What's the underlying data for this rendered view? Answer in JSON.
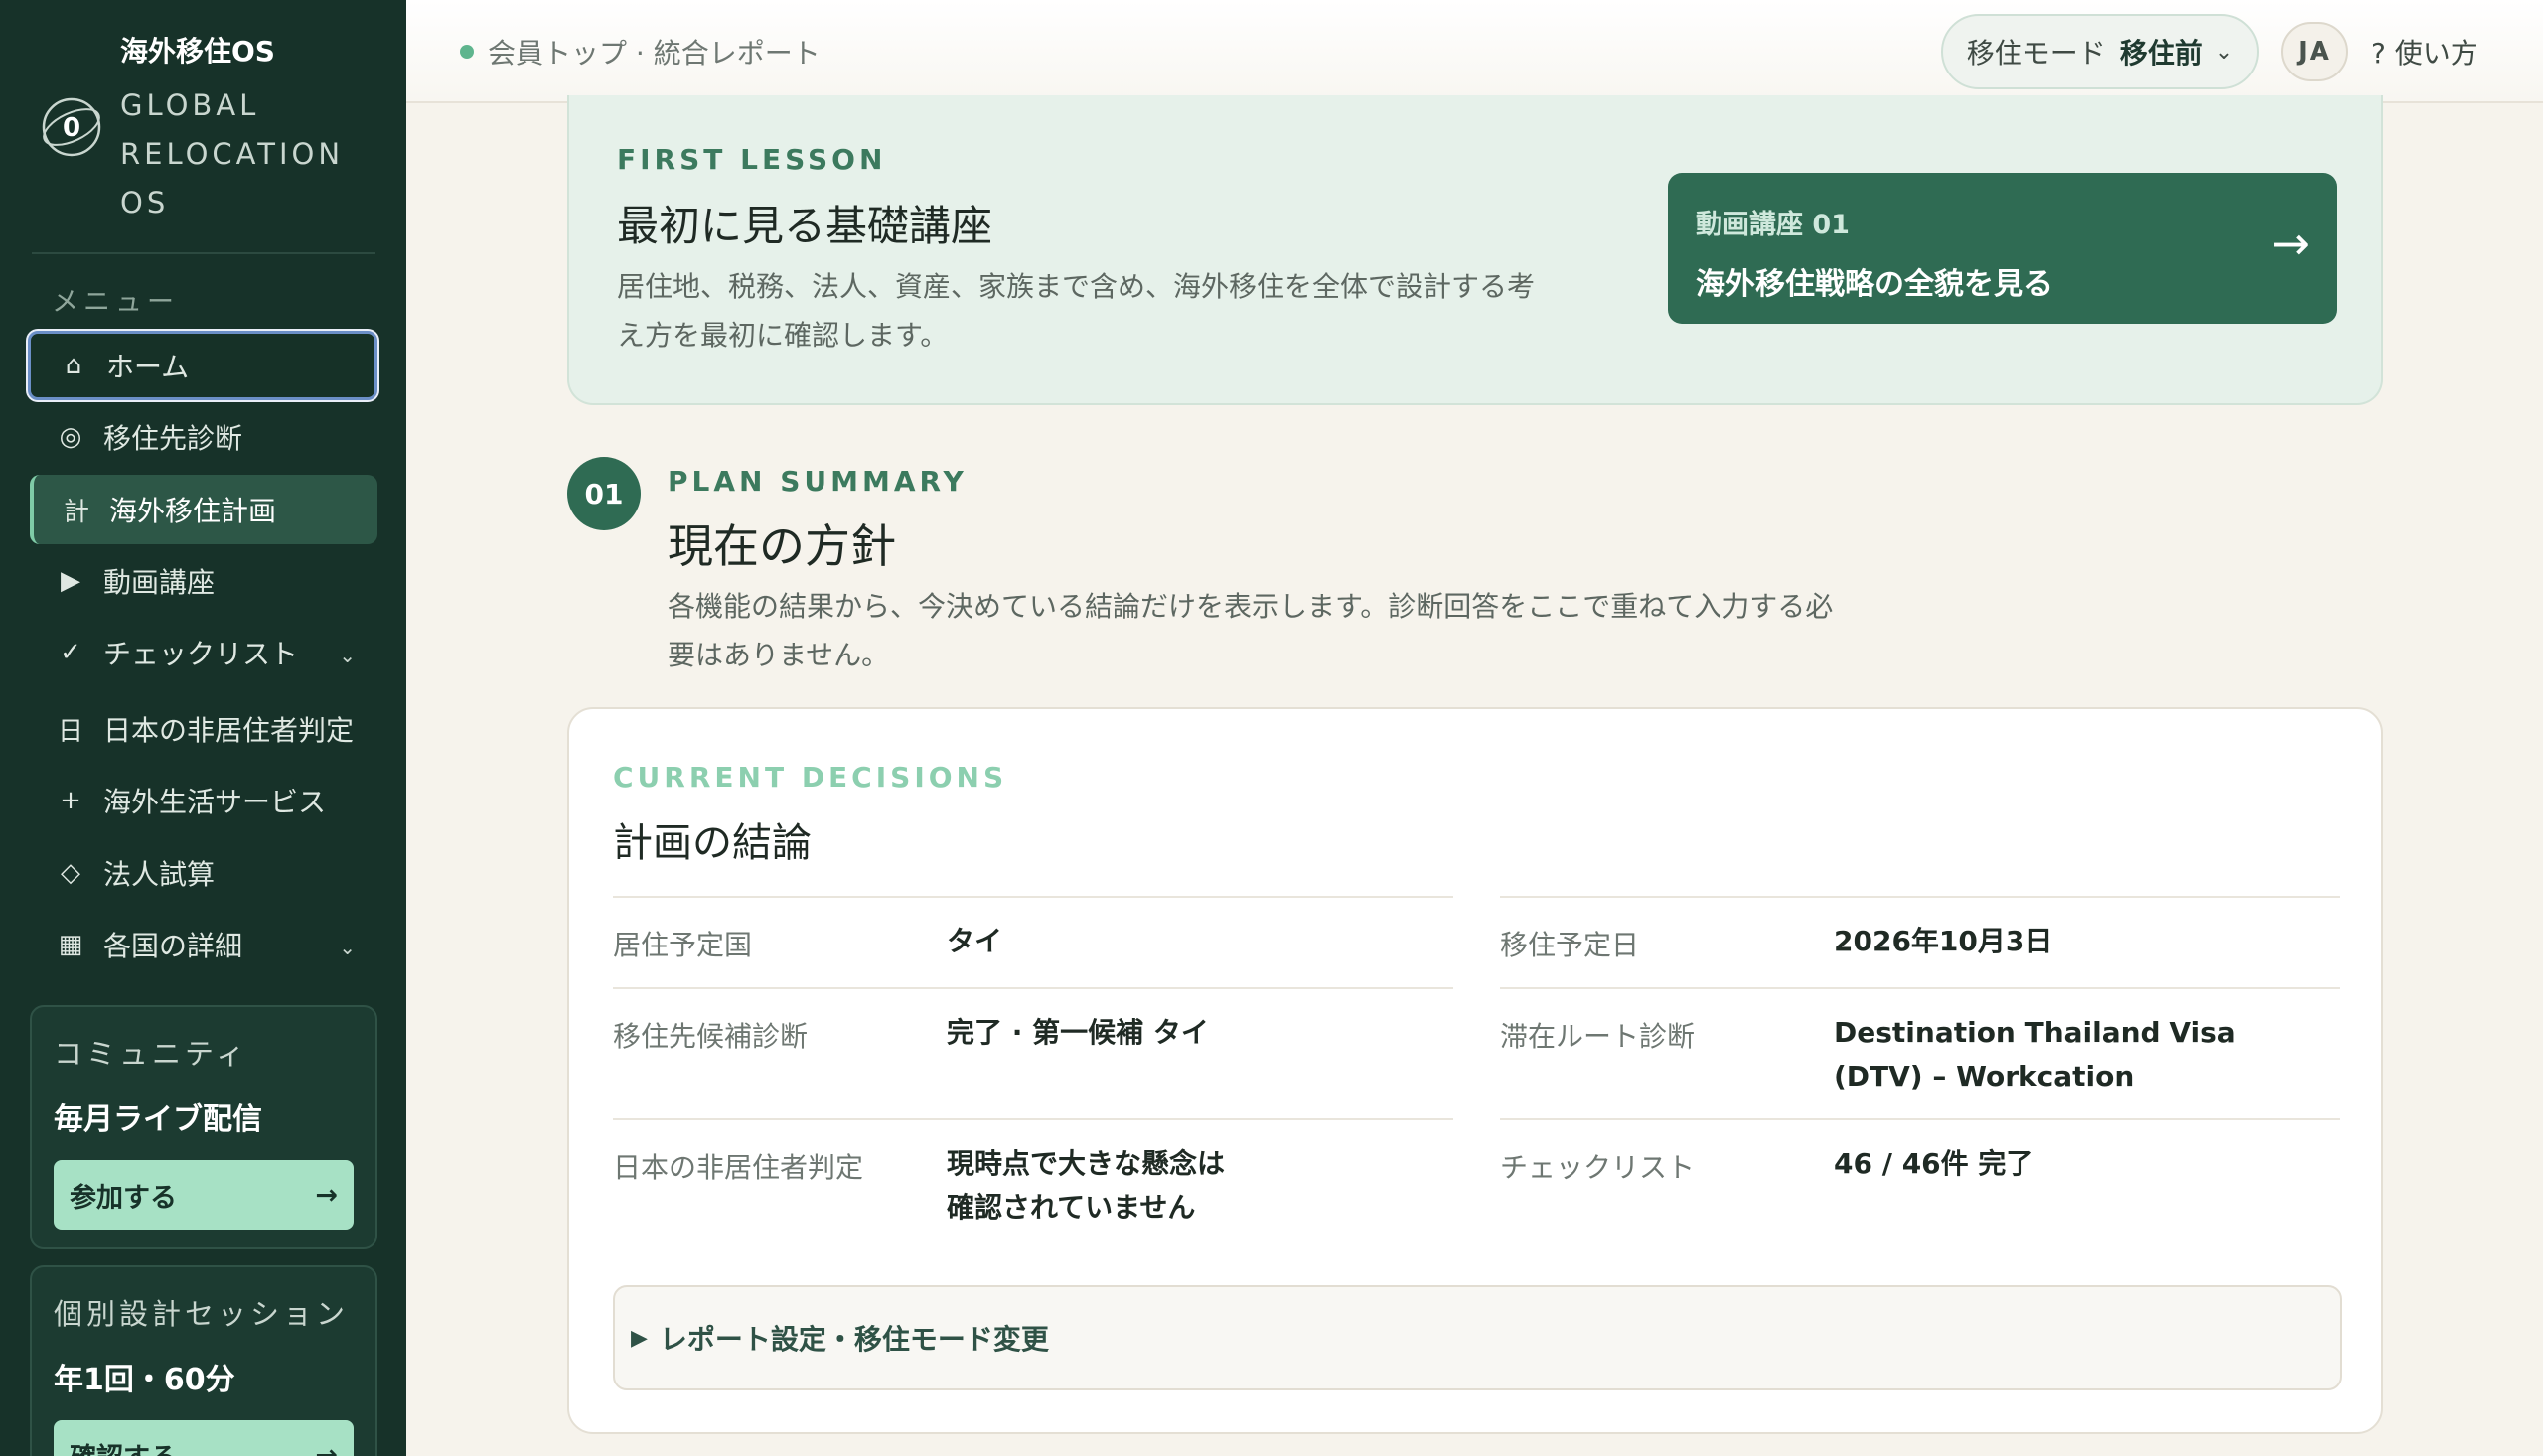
{
  "sidebar": {
    "brand_title": "海外移住OS",
    "brand_logo_letter": "0",
    "brand_sub": "GLOBAL RELOCATION OS",
    "menu_heading": "メニュー",
    "items": [
      {
        "icon": "⌂",
        "icon_name": "home-icon",
        "label": "ホーム"
      },
      {
        "icon": "◎",
        "icon_name": "target-icon",
        "label": "移住先診断"
      },
      {
        "icon": "計",
        "icon_name": "plan-icon",
        "label": "海外移住計画"
      },
      {
        "icon": "▶",
        "icon_name": "play-icon",
        "label": "動画講座"
      },
      {
        "icon": "✓",
        "icon_name": "check-icon",
        "label": "チェックリスト",
        "chevron": "⌄"
      },
      {
        "icon": "日",
        "icon_name": "japan-icon",
        "label": "日本の非居住者判定"
      },
      {
        "icon": "+",
        "icon_name": "plus-icon",
        "label": "海外生活サービス"
      },
      {
        "icon": "◇",
        "icon_name": "diamond-icon",
        "label": "法人試算"
      },
      {
        "icon": "▦",
        "icon_name": "grid-icon",
        "label": "各国の詳細",
        "chevron": "⌄"
      }
    ],
    "community": {
      "label": "コミュニティ",
      "title": "毎月ライブ配信",
      "button": "参加する",
      "arrow": "→"
    },
    "session": {
      "label": "個別設計セッション",
      "title": "年1回・60分",
      "button": "確認する",
      "arrow": "→"
    }
  },
  "topbar": {
    "breadcrumb": "会員トップ · 統合レポート",
    "mode_label": "移住モード",
    "mode_value": "移住前",
    "mode_chevron": "⌄",
    "lang": "JA",
    "help": "? 使い方"
  },
  "lesson": {
    "eyebrow": "FIRST LESSON",
    "title": "最初に見る基礎講座",
    "desc": "居住地、税務、法人、資産、家族まで含め、海外移住を全体で設計する考え方を最初に確認します。",
    "button_small": "動画講座 01",
    "button_big": "海外移住戦略の全貌を見る",
    "button_arrow": "→"
  },
  "plan": {
    "step": "01",
    "eyebrow": "PLAN SUMMARY",
    "title": "現在の方針",
    "desc": "各機能の結果から、今決めている結論だけを表示します。診断回答をここで重ねて入力する必要はありません。"
  },
  "decisions": {
    "eyebrow": "CURRENT DECISIONS",
    "title": "計画の結論",
    "rows": [
      {
        "label": "居住予定国",
        "value": "タイ"
      },
      {
        "label": "移住予定日",
        "value": "2026年10月3日"
      },
      {
        "label": "移住先候補診断",
        "value": "完了 · 第一候補 タイ"
      },
      {
        "label": "滞在ルート診断",
        "value": "Destination Thailand Visa (DTV) – Workcation"
      },
      {
        "label": "日本の非居住者判定",
        "value": "現時点で大きな懸念は確認されていません"
      },
      {
        "label": "チェックリスト",
        "value": "46 / 46件 完了"
      }
    ],
    "details_triangle": "▶",
    "details_label": "レポート設定・移住モード変更"
  }
}
